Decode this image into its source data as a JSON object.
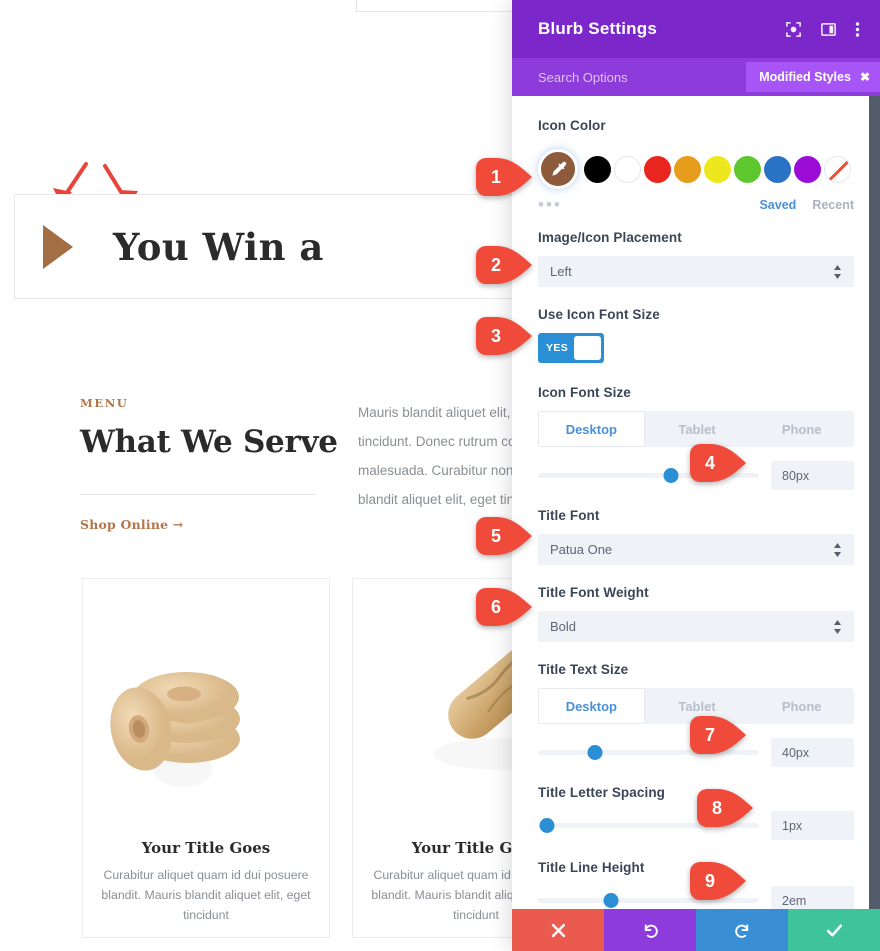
{
  "preview": {
    "hero": {
      "title": "You Win a",
      "icon": "triangle-play-icon"
    },
    "menu": {
      "eyebrow": "MENU",
      "heading": "What We Serve",
      "link": "Shop Online  →",
      "paragraph": "Mauris blandit aliquet elit, eget tincidunt. Donec rutrum congue malesuada. Curabitur non nulla blandit aliquet elit, eget tincidunt"
    },
    "cards": [
      {
        "image": "bagels-photo",
        "title": "Your Title Goes",
        "desc": "Curabitur aliquet quam id dui posuere blandit. Mauris blandit aliquet elit, eget tincidunt"
      },
      {
        "image": "baguette-photo",
        "title": "Your Title Goes",
        "desc": "Curabitur aliquet quam id dui posuere blandit. Mauris blandit aliquet elit, eget tincidunt"
      }
    ]
  },
  "panel": {
    "title": "Blurb Settings",
    "header_icons": [
      "expand-icon",
      "layout-icon",
      "more-vertical-icon"
    ],
    "search_placeholder": "Search Options",
    "modified_styles_label": "Modified Styles",
    "modified_styles_close": "✖",
    "icon_color": {
      "label": "Icon Color",
      "active_value": "#8d5a3b",
      "active_icon": "eyedropper-icon",
      "swatches": [
        "#000000",
        "#ffffff",
        "#e8261f",
        "#e89c1c",
        "#ece81d",
        "#5fc72e",
        "#2a72c4",
        "#9b0dd6",
        "none"
      ],
      "more_dots": "•••",
      "saved_label": "Saved",
      "recent_label": "Recent"
    },
    "placement": {
      "label": "Image/Icon Placement",
      "value": "Left"
    },
    "use_icon_font_size": {
      "label": "Use Icon Font Size",
      "value": "YES"
    },
    "icon_font_size": {
      "label": "Icon Font Size",
      "devices": [
        "Desktop",
        "Tablet",
        "Phone"
      ],
      "active_device": "Desktop",
      "value": "80px",
      "slider_percent": 60
    },
    "title_font": {
      "label": "Title Font",
      "value": "Patua One"
    },
    "title_font_weight": {
      "label": "Title Font Weight",
      "value": "Bold"
    },
    "title_text_size": {
      "label": "Title Text Size",
      "devices": [
        "Desktop",
        "Tablet",
        "Phone"
      ],
      "active_device": "Desktop",
      "value": "40px",
      "slider_percent": 26
    },
    "title_letter_spacing": {
      "label": "Title Letter Spacing",
      "value": "1px",
      "slider_percent": 3
    },
    "title_line_height": {
      "label": "Title Line Height",
      "value": "2em",
      "slider_percent": 33
    },
    "footer": {
      "cancel": "✖",
      "undo": "↺",
      "redo": "↻",
      "save": "✔"
    }
  },
  "callouts": [
    {
      "n": "1"
    },
    {
      "n": "2"
    },
    {
      "n": "3"
    },
    {
      "n": "4"
    },
    {
      "n": "5"
    },
    {
      "n": "6"
    },
    {
      "n": "7"
    },
    {
      "n": "8"
    },
    {
      "n": "9"
    }
  ],
  "colors": {
    "panel_header": "#7b27c9",
    "panel_search": "#8e3bdc",
    "accent_blue": "#2a8fd4",
    "callout_red": "#f04a3a",
    "brand_brown": "#a36e43"
  }
}
